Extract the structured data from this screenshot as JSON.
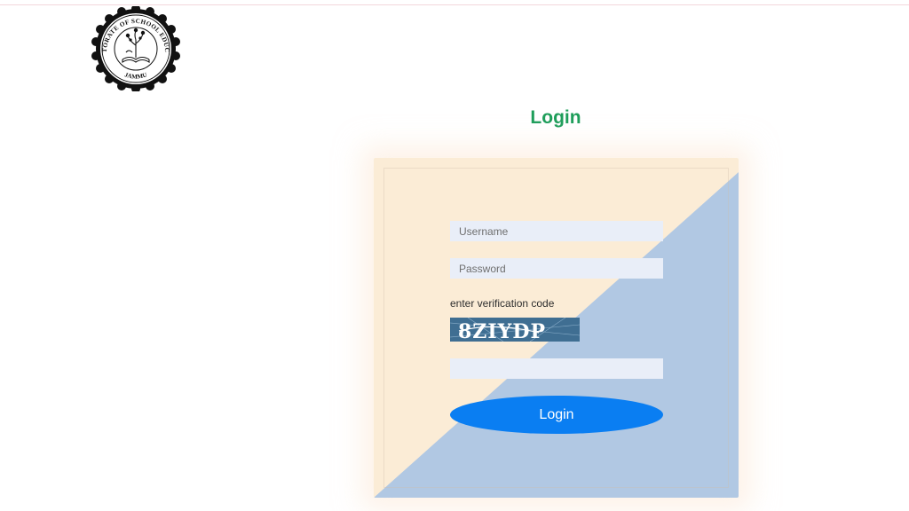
{
  "logo": {
    "arc_text_top": "DIRECTORATE OF SCHOOL EDUCATION",
    "arc_text_bottom": "JAMMU"
  },
  "heading": "Login",
  "form": {
    "username_placeholder": "Username",
    "password_placeholder": "Password",
    "verification_label": "enter verification code",
    "captcha_text": "8ZIYDP",
    "captcha_value": "",
    "submit_label": "Login"
  },
  "colors": {
    "heading": "#1e9e5a",
    "card_light": "#fbecd6",
    "card_blue": "#b1c8e3",
    "field_bg": "#e9eef8",
    "button": "#0a7ef2",
    "captcha_bg": "#3f6e92"
  }
}
